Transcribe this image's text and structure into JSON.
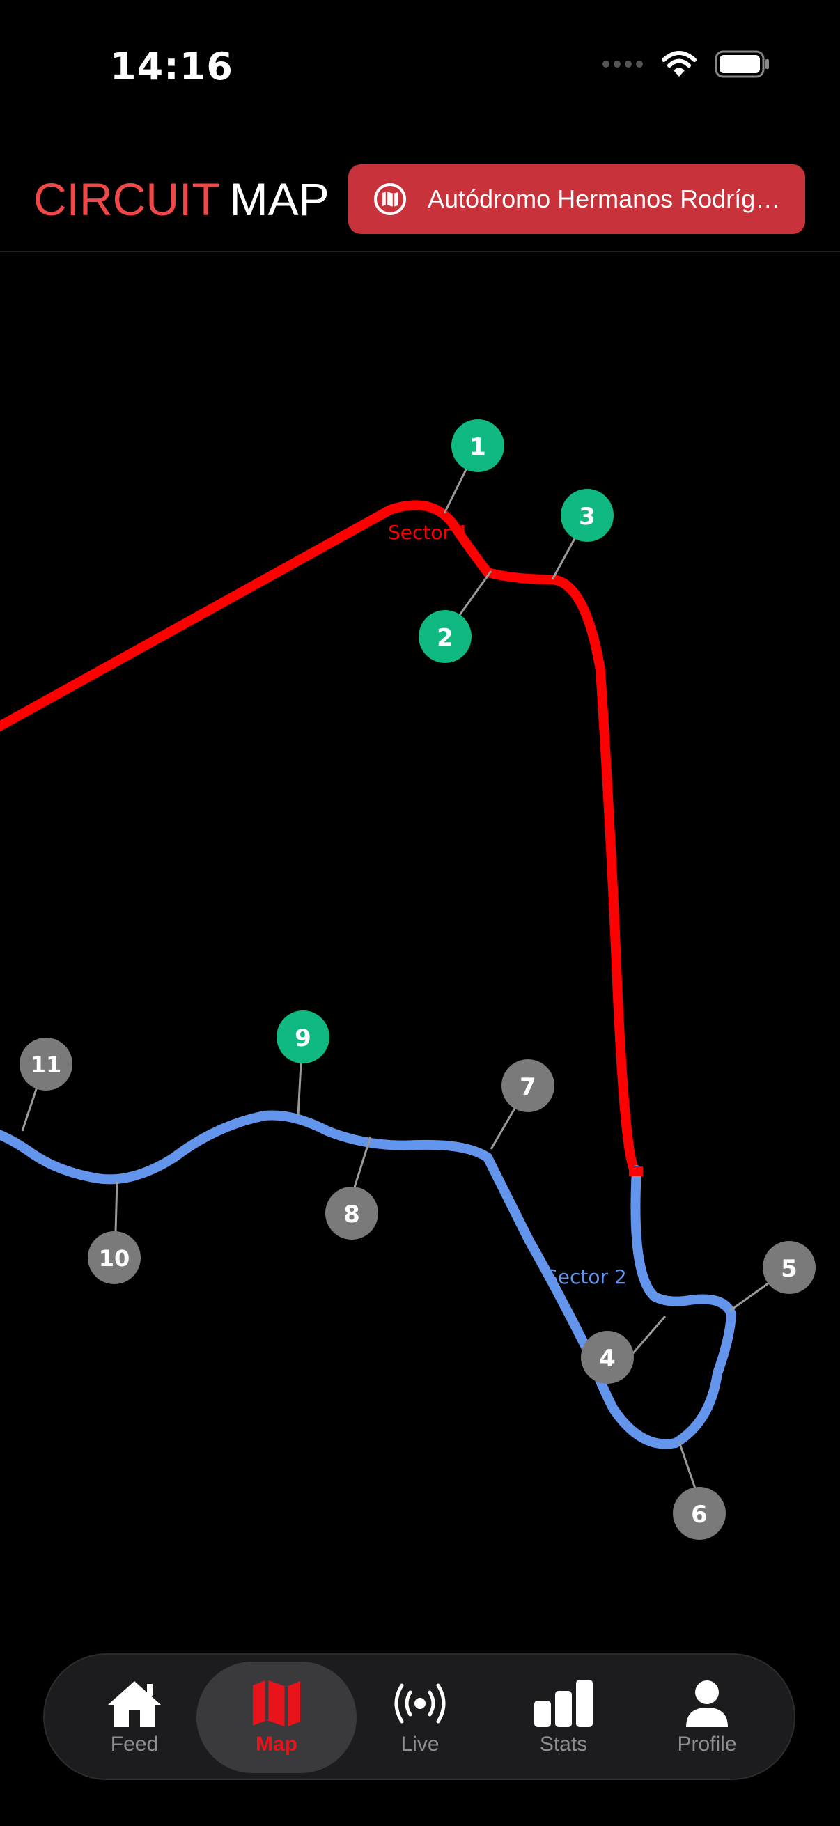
{
  "status": {
    "time": "14:16"
  },
  "header": {
    "title_part1": "CIRCUIT",
    "title_part2": "MAP",
    "circuit_name": "Autódromo Hermanos Rodríg…"
  },
  "map": {
    "sector_labels": [
      {
        "text": "Sector 1",
        "color": "#ff0000"
      },
      {
        "text": "Sector 2",
        "color": "#6495ed"
      }
    ],
    "corners": [
      {
        "n": "1",
        "type": "drs"
      },
      {
        "n": "2",
        "type": "drs"
      },
      {
        "n": "3",
        "type": "drs"
      },
      {
        "n": "4",
        "type": "normal"
      },
      {
        "n": "5",
        "type": "normal"
      },
      {
        "n": "6",
        "type": "normal"
      },
      {
        "n": "7",
        "type": "normal"
      },
      {
        "n": "8",
        "type": "normal"
      },
      {
        "n": "9",
        "type": "drs"
      },
      {
        "n": "10",
        "type": "normal"
      },
      {
        "n": "11",
        "type": "normal"
      }
    ],
    "colors": {
      "sector1": "#ff0000",
      "sector2": "#6495ed",
      "corner_drs": "#10b981",
      "corner_normal": "#7a7a7a"
    }
  },
  "tabs": [
    {
      "label": "Feed",
      "icon": "house-icon",
      "active": false
    },
    {
      "label": "Map",
      "icon": "map-icon",
      "active": true
    },
    {
      "label": "Live",
      "icon": "broadcast-icon",
      "active": false
    },
    {
      "label": "Stats",
      "icon": "bar-chart-icon",
      "active": false
    },
    {
      "label": "Profile",
      "icon": "person-icon",
      "active": false
    }
  ]
}
